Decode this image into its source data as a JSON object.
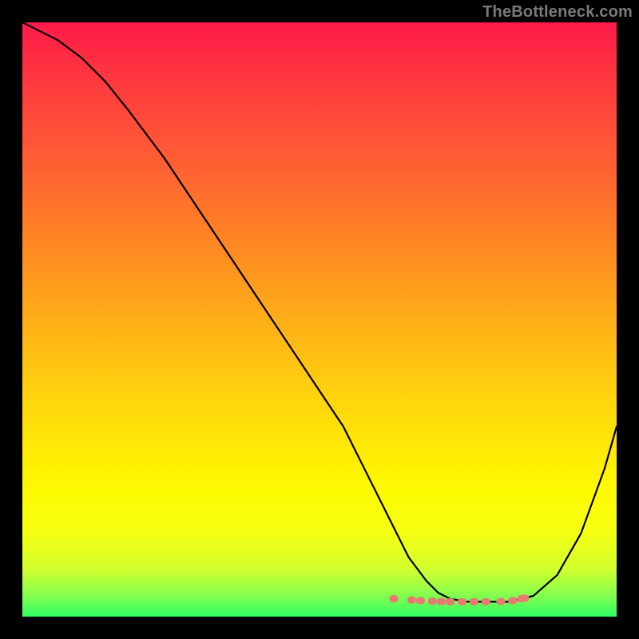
{
  "watermark": "TheBottleneck.com",
  "chart_data": {
    "type": "line",
    "title": "",
    "xlabel": "",
    "ylabel": "",
    "xlim": [
      0,
      100
    ],
    "ylim": [
      0,
      100
    ],
    "series": [
      {
        "name": "curve",
        "x": [
          0,
          2,
          6,
          10,
          14,
          18,
          24,
          30,
          36,
          42,
          48,
          54,
          58,
          62,
          65,
          68,
          70,
          72,
          75,
          78,
          82,
          86,
          90,
          94,
          98,
          100
        ],
        "values": [
          100,
          99,
          97,
          94,
          90,
          85,
          77,
          68,
          59,
          50,
          41,
          32,
          24,
          16,
          10,
          6,
          4,
          3,
          2.5,
          2.5,
          2.5,
          3.5,
          7,
          14,
          25,
          32
        ]
      },
      {
        "name": "markers",
        "x": [
          62.5,
          65.5,
          67,
          69,
          70.5,
          72,
          74,
          76,
          78,
          80.5,
          82.5,
          84,
          84.5
        ],
        "values": [
          3.0,
          2.8,
          2.7,
          2.6,
          2.55,
          2.5,
          2.5,
          2.5,
          2.5,
          2.55,
          2.7,
          3.0,
          3.1
        ]
      }
    ]
  }
}
